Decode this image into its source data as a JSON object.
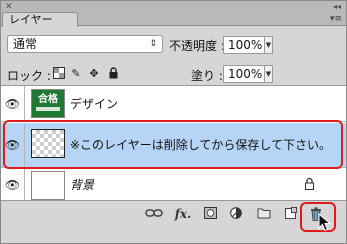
{
  "panel": {
    "tab_label": "レイヤー",
    "close_glyph": "✕",
    "collapse_glyph": "◂◂",
    "menu_glyph": "▾≡"
  },
  "blend_mode": {
    "value": "通常"
  },
  "opacity": {
    "label": "不透明度 :",
    "value": "100%"
  },
  "lock": {
    "label": "ロック :"
  },
  "fill": {
    "label": "塗り :",
    "value": "100%"
  },
  "layers": [
    {
      "name": "デザイン",
      "visible": true,
      "thumbnail_text": "合格"
    },
    {
      "name": "※このレイヤーは削除してから保存して下さい。",
      "visible": true,
      "selected": true
    },
    {
      "name": "背景",
      "visible": true,
      "locked": true
    }
  ],
  "bottom_bar": {
    "fx_label": "fx."
  },
  "colors": {
    "selection": "#b6d4f5",
    "highlight_outline": "#e01b1b",
    "panel_bg": "#d6d6d6"
  }
}
